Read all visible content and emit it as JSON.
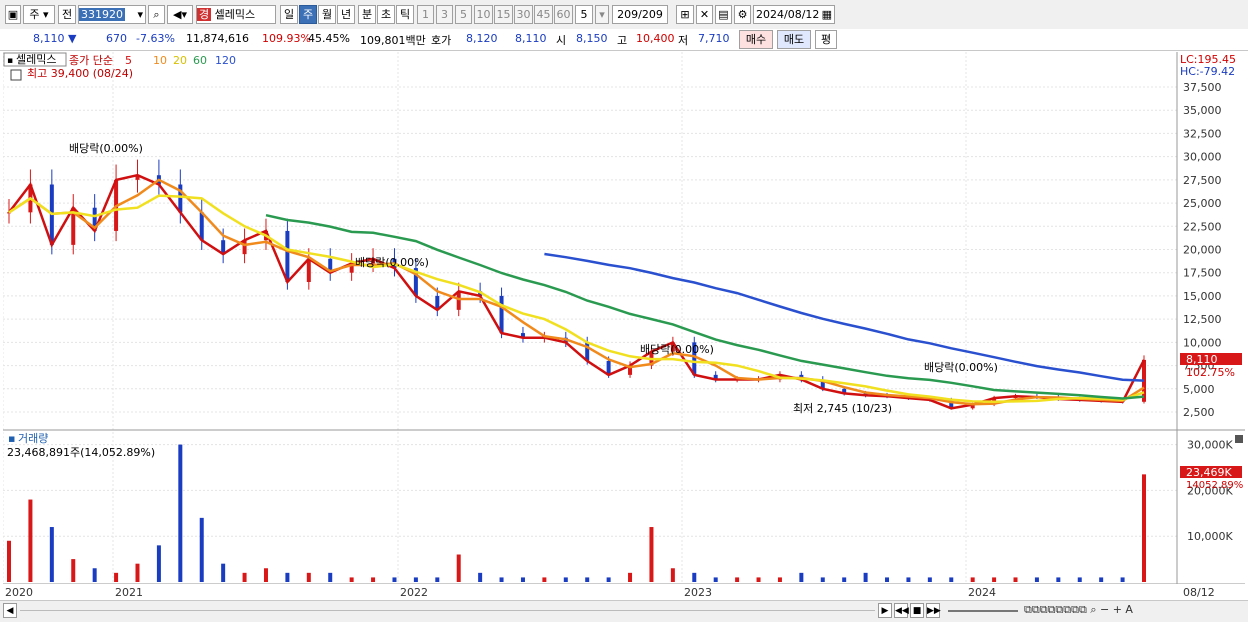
{
  "toolbar": {
    "market": "주",
    "type": "전",
    "code": "331920",
    "stock_badge": "경",
    "stock_name": "셀레믹스",
    "periods": [
      "일",
      "주",
      "월",
      "년",
      "분",
      "초",
      "틱"
    ],
    "selected_period": "주",
    "intervals": [
      "1",
      "3",
      "5",
      "10",
      "15",
      "30",
      "45",
      "60"
    ],
    "count": "5",
    "page": "209/209",
    "date": "2024/08/12"
  },
  "quote": {
    "price": "8,110",
    "change": "670",
    "change_pct": "-7.63%",
    "volume": "11,874,616",
    "vol_ratio": "109.93%",
    "turnover_pct": "45.45%",
    "amount": "109,801백만",
    "bid_label": "호가",
    "bid": "8,120",
    "bid2": "8,110",
    "open_label": "시",
    "open": "8,150",
    "high_label": "고",
    "high": "10,400",
    "low_label": "저",
    "low": "7,710",
    "buy_label": "매수",
    "sell_label": "매도",
    "eval_label": "평"
  },
  "chart": {
    "stock_tab": "셀레믹스",
    "legend_prefix": "종가 단순",
    "ma_periods": [
      "5",
      "10",
      "20",
      "60",
      "120"
    ],
    "ma_colors": [
      "#d01010",
      "#f08a1c",
      "#f0e020",
      "#2a9a50",
      "#2a50d0"
    ],
    "lc_label": "LC:195.45",
    "hc_label": "HC:-79.42",
    "high_note": "최고 39,400 (08/24)",
    "low_note": "최저 2,745 (10/23)",
    "dividend_label": "배당락(0.00%)",
    "current_price_label": "8,110",
    "current_pct_label": "102.75%",
    "volume_title": "거래량",
    "volume_info": "23,468,891주(14,052.89%)",
    "vol_current_label": "23,469K",
    "vol_pct_label": "14052.89%",
    "x_labels": [
      "2020",
      "2021",
      "2022",
      "2023",
      "2024",
      "08/12"
    ]
  },
  "chart_data": {
    "type": "candlestick",
    "period": "weekly",
    "price_axis": [
      2500,
      5000,
      7500,
      10000,
      12500,
      15000,
      17500,
      20000,
      22500,
      25000,
      27500,
      30000,
      32500,
      35000,
      37500
    ],
    "volume_axis_labels": [
      "10,000K",
      "20,000K",
      "30,000K"
    ],
    "close": [
      24000,
      27000,
      20500,
      24500,
      22000,
      27500,
      28000,
      27000,
      24000,
      21000,
      19500,
      21000,
      22000,
      16500,
      19000,
      17500,
      18500,
      19000,
      18000,
      15000,
      13500,
      15500,
      15000,
      11000,
      10500,
      10500,
      10000,
      8000,
      6500,
      7500,
      9000,
      10000,
      6500,
      6000,
      6000,
      6000,
      6500,
      6000,
      5000,
      4500,
      4300,
      4200,
      4000,
      3800,
      2900,
      3300,
      4000,
      4200,
      4100,
      3900,
      3800,
      3700,
      3600,
      8110
    ],
    "volume": [
      9,
      18,
      12,
      5,
      3,
      2,
      4,
      8,
      30,
      14,
      4,
      2,
      3,
      2,
      2,
      2,
      1,
      1,
      1,
      1,
      1,
      6,
      2,
      1,
      1,
      1,
      1,
      1,
      1,
      2,
      12,
      3,
      2,
      1,
      1,
      1,
      1,
      2,
      1,
      1,
      2,
      1,
      1,
      1,
      1,
      1,
      1,
      1,
      1,
      1,
      1,
      1,
      1,
      23.5
    ],
    "volume_unit": "M shares",
    "last_volume": 23468891
  }
}
